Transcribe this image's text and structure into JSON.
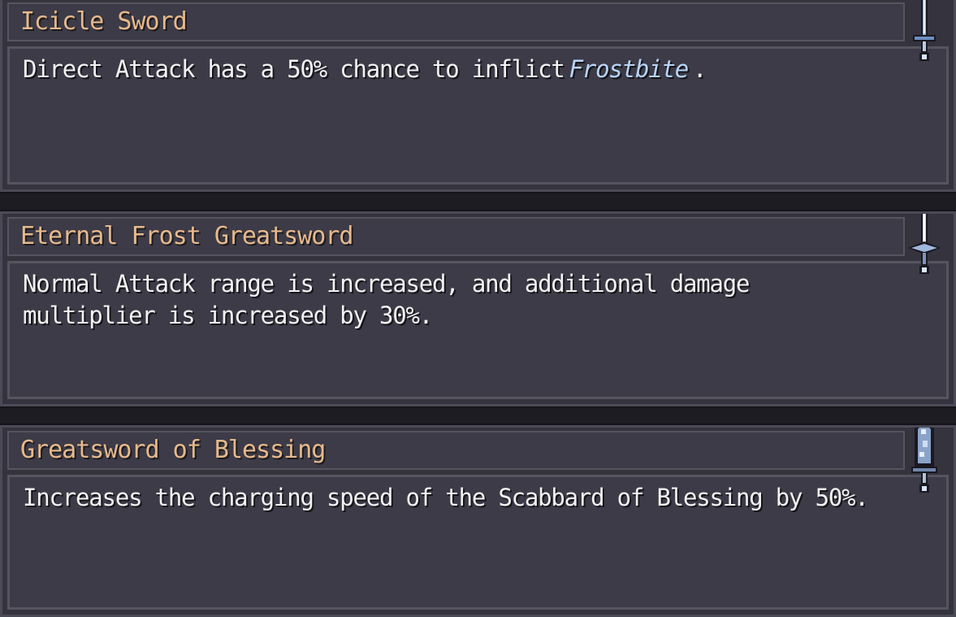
{
  "colors": {
    "background": "#1d1c23",
    "panel": "#34333e",
    "title_text": "#e7b98b",
    "body_text": "#f2f2f2",
    "keyword_text": "#b9d4f7"
  },
  "items": [
    {
      "title": "Icicle Sword",
      "desc_before": "Direct Attack has a 50% chance to inflict",
      "desc_keyword": "Frostbite",
      "desc_after": ".",
      "icon": "icicle-sword-icon"
    },
    {
      "title": "Eternal Frost Greatsword",
      "desc": "Normal Attack range is increased, and additional damage multiplier is increased by 30%.",
      "icon": "eternal-frost-greatsword-icon"
    },
    {
      "title": "Greatsword of Blessing",
      "desc": "Increases the charging speed of the Scabbard of Blessing by 50%.",
      "icon": "greatsword-of-blessing-icon"
    }
  ]
}
